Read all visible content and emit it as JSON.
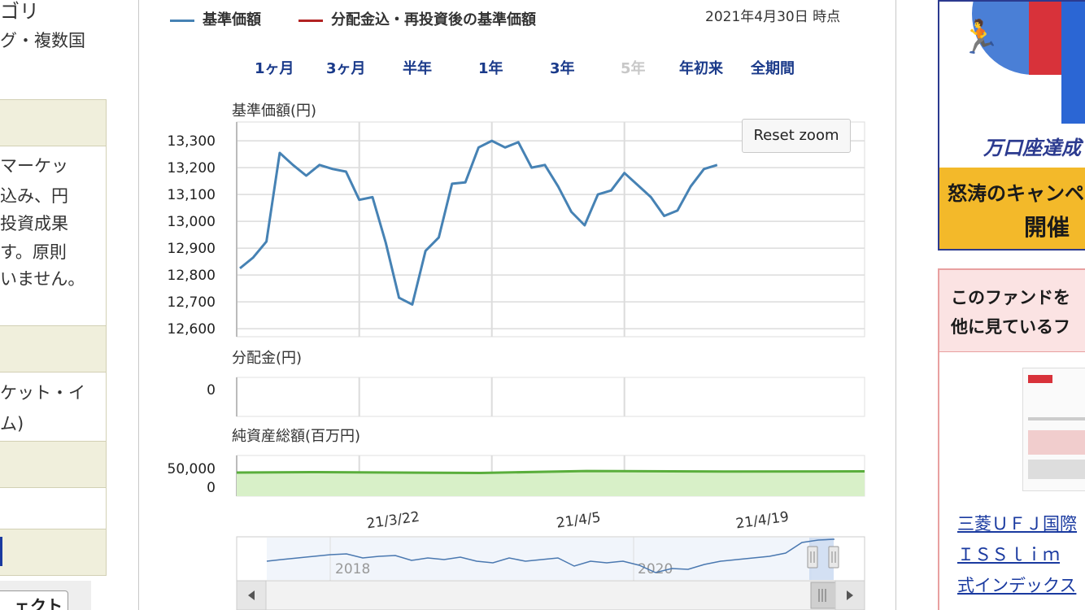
{
  "left_column": {
    "lines": [
      "ゴリ",
      "グ・複数国",
      "マーケッ",
      "込み、円",
      "投資成果",
      "す。原則",
      "いません。",
      "ケット・イ",
      "ム)",
      "ェクト"
    ]
  },
  "chart": {
    "legend": [
      {
        "label": "基準価額",
        "color": "#4682b4"
      },
      {
        "label": "分配金込・再投資後の基準価額",
        "color": "#b22222"
      }
    ],
    "date_note": "2021年4月30日 時点",
    "periods": [
      {
        "label": "1ヶ月",
        "enabled": true
      },
      {
        "label": "3ヶ月",
        "enabled": true
      },
      {
        "label": "半年",
        "enabled": true
      },
      {
        "label": "1年",
        "enabled": true
      },
      {
        "label": "3年",
        "enabled": true
      },
      {
        "label": "5年",
        "enabled": false
      },
      {
        "label": "年初来",
        "enabled": true
      },
      {
        "label": "全期間",
        "enabled": true
      }
    ],
    "reset_zoom": "Reset zoom",
    "navigator_years": [
      "2018",
      "2020"
    ]
  },
  "chart_data": [
    {
      "type": "line",
      "title": "基準価額(円)",
      "ylabel": "基準価額(円)",
      "ylim": [
        12570,
        13370
      ],
      "yticks": [
        12600,
        12700,
        12800,
        12900,
        13000,
        13100,
        13200,
        13300
      ],
      "ytick_labels": [
        "12,600",
        "12,700",
        "12,800",
        "12,900",
        "13,000",
        "13,100",
        "13,200",
        "13,300"
      ],
      "xticks": [
        "21/3/22",
        "21/4/5",
        "21/4/19"
      ],
      "grid": true,
      "series": [
        {
          "name": "基準価額",
          "color": "#4682b4",
          "x": [
            "21/3/9",
            "21/3/10",
            "21/3/11",
            "21/3/12",
            "21/3/15",
            "21/3/16",
            "21/3/17",
            "21/3/18",
            "21/3/19",
            "21/3/22",
            "21/3/23",
            "21/3/24",
            "21/3/25",
            "21/3/26",
            "21/3/29",
            "21/3/30",
            "21/3/31",
            "21/4/1",
            "21/4/2",
            "21/4/5",
            "21/4/6",
            "21/4/7",
            "21/4/8",
            "21/4/9",
            "21/4/12",
            "21/4/13",
            "21/4/14",
            "21/4/15",
            "21/4/16",
            "21/4/19",
            "21/4/20",
            "21/4/21",
            "21/4/22",
            "21/4/23",
            "21/4/26",
            "21/4/27",
            "21/4/28"
          ],
          "values": [
            12825,
            12865,
            12925,
            13255,
            13210,
            13170,
            13210,
            13195,
            13185,
            13080,
            13090,
            12920,
            12715,
            12690,
            12890,
            12940,
            13140,
            13145,
            13275,
            13300,
            13275,
            13295,
            13200,
            13210,
            13130,
            13035,
            12985,
            13100,
            13115,
            13180,
            13135,
            13090,
            13020,
            13040,
            13130,
            13195,
            13210
          ]
        }
      ]
    },
    {
      "type": "line",
      "title": "分配金(円)",
      "ylabel": "分配金(円)",
      "yticks": [
        0
      ],
      "ytick_labels": [
        "0"
      ],
      "series": [
        {
          "name": "分配金",
          "values": [
            0
          ]
        }
      ]
    },
    {
      "type": "area",
      "title": "純資産総額(百万円)",
      "ylabel": "純資産総額(百万円)",
      "ylim": [
        0,
        100000
      ],
      "yticks": [
        0,
        50000
      ],
      "ytick_labels": [
        "0",
        "50,000"
      ],
      "series": [
        {
          "name": "純資産総額",
          "color": "#5aae3c",
          "x": [
            "21/3/9",
            "21/4/28"
          ],
          "values": [
            58000,
            61000
          ]
        }
      ]
    }
  ],
  "right_column": {
    "banner_text": "万口座達成",
    "campaign_line1": "怒涛のキャンペ",
    "campaign_line2": "開催",
    "fund_header_line1": "このファンドを",
    "fund_header_line2": "他に見ているフ",
    "fund_links": [
      "三菱ＵＦＪ国際",
      "ＩＳＳｌｉｍ",
      "式インデックス"
    ]
  }
}
